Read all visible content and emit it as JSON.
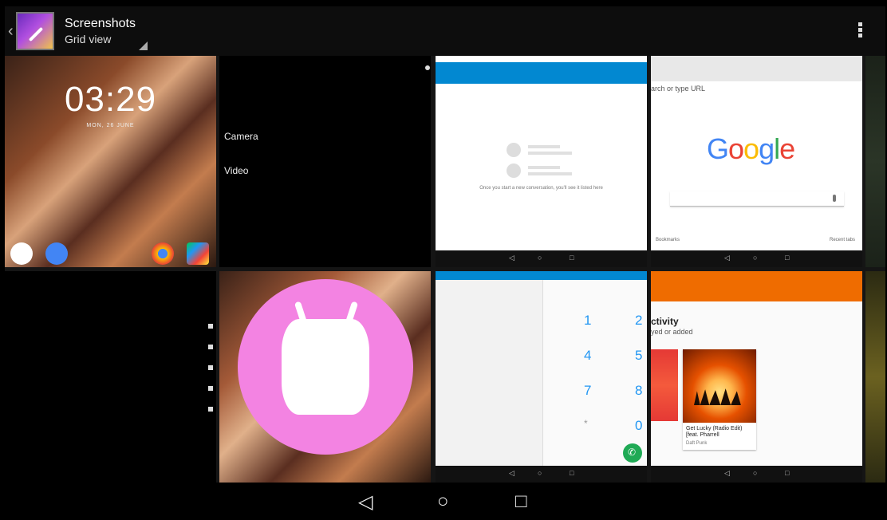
{
  "actionbar": {
    "back_glyph": "‹",
    "title": "Screenshots",
    "subtitle": "Grid view"
  },
  "tiles": {
    "lockscreen": {
      "time": "03:29",
      "date": "MON, 26 JUNE"
    },
    "camera_settings": {
      "items": [
        "Camera",
        "Video"
      ]
    },
    "messages": {
      "empty_text": "Once you start a new conversation, you'll see it listed here"
    },
    "browser": {
      "url_placeholder": "arch or type URL",
      "logo": "Google",
      "bottom_left": "Bookmarks",
      "bottom_right": "Recent tabs"
    },
    "dialer": {
      "keys": [
        "1",
        "2",
        "4",
        "5",
        "7",
        "8",
        "*",
        "0"
      ]
    },
    "music": {
      "heading": "ctivity",
      "subheading": "yed or added",
      "song": "Get Lucky (Radio Edit) [feat. Pharrell",
      "artist": "Daft Punk"
    }
  },
  "mini_nav": {
    "back": "◁",
    "home": "○",
    "recents": "□"
  },
  "system_nav": {
    "back": "◁",
    "home": "○",
    "recents": "□"
  },
  "colors": {
    "blue_bar": "#0288d1",
    "orange_bar": "#ef6c00",
    "marshmallow": "#f383e2"
  }
}
